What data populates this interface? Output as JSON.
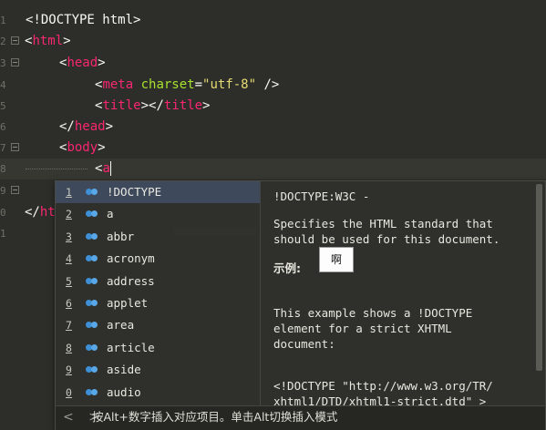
{
  "gutter": [
    "1",
    "2",
    "3",
    "4",
    "5",
    "6",
    "7",
    "8",
    "9",
    "0",
    "1"
  ],
  "code": {
    "l1": "<!DOCTYPE html>",
    "l2_open": "<",
    "l2_tag": "html",
    "l2_close": ">",
    "l3_open": "<",
    "l3_tag": "head",
    "l3_close": ">",
    "l4_open": "<",
    "l4_tag": "meta",
    "l4_attr": " charset",
    "l4_eq": "=",
    "l4_str": "\"utf-8\"",
    "l4_end": " />",
    "l5_open": "<",
    "l5_tag": "title",
    "l5_mid": "></",
    "l5_tag2": "title",
    "l5_close": ">",
    "l6_open": "</",
    "l6_tag": "head",
    "l6_close": ">",
    "l7_open": "<",
    "l7_tag": "body",
    "l7_close": ">",
    "l8_open": "<",
    "l8_typed": "a",
    "l10_open": "</",
    "l10_tag": "ht"
  },
  "autocomplete": {
    "items": [
      {
        "num": "1",
        "label": "!DOCTYPE"
      },
      {
        "num": "2",
        "label": "a"
      },
      {
        "num": "3",
        "label": "abbr"
      },
      {
        "num": "4",
        "label": "acronym"
      },
      {
        "num": "5",
        "label": "address"
      },
      {
        "num": "6",
        "label": "applet"
      },
      {
        "num": "7",
        "label": "area"
      },
      {
        "num": "8",
        "label": "article"
      },
      {
        "num": "9",
        "label": "aside"
      },
      {
        "num": "0",
        "label": "audio"
      }
    ],
    "selected_index": 0,
    "doc": {
      "title": "!DOCTYPE:W3C -",
      "desc1": "Specifies the HTML standard that",
      "desc2": "should be used for this document.",
      "example_heading": "示例:",
      "ex1": "This example shows a !DOCTYPE",
      "ex2": "element for a strict XHTML",
      "ex3": "document:",
      "ex4": "<!DOCTYPE \"http://www.w3.org/TR/",
      "ex5": "xhtml1/DTD/xhtml1-strict.dtd\" >"
    },
    "tooltip": "啊",
    "status_arrows": "< >",
    "status_text": "按Alt+数字插入对应项目。单击Alt切换插入模式"
  },
  "colors": {
    "background": "#2d2e2a",
    "tag": "#f92672",
    "attr": "#a6e22e",
    "string": "#e6db74",
    "selected": "#3e4a5c"
  }
}
